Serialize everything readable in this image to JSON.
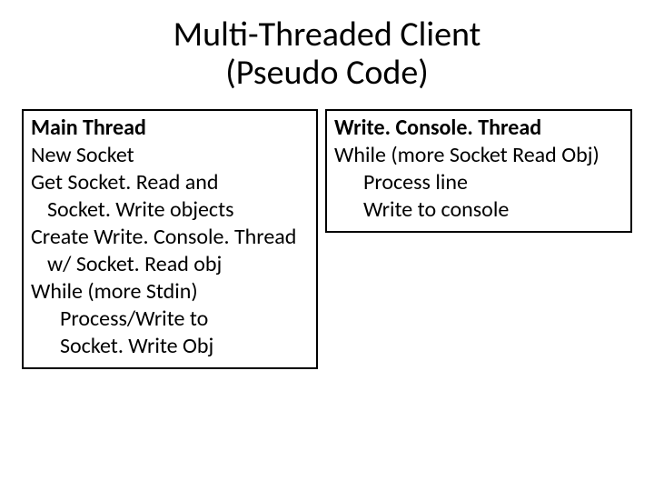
{
  "title_line1": "Multi-Threaded Client",
  "title_line2": "(Pseudo Code)",
  "left": {
    "header": "Main Thread",
    "l1": "New Socket",
    "l2": "Get Socket. Read and",
    "l3": "Socket. Write objects",
    "l4": "Create Write. Console. Thread",
    "l5": "w/ Socket. Read obj",
    "l6": "While (more Stdin)",
    "l7": "Process/Write to",
    "l8": "Socket. Write Obj"
  },
  "right": {
    "header": "Write. Console. Thread",
    "l1": "While (more Socket Read Obj)",
    "l2": "Process line",
    "l3": "Write to console"
  }
}
